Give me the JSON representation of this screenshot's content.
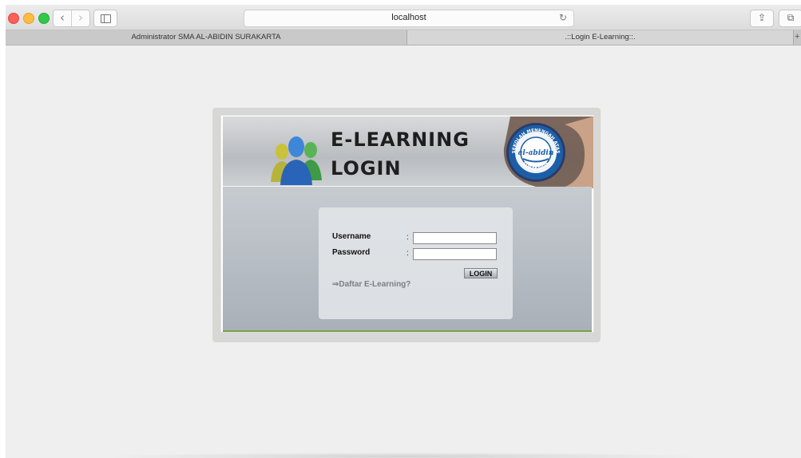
{
  "browser": {
    "url": "localhost",
    "back_icon": "‹",
    "forward_icon": "›",
    "reload_icon": "↻",
    "share_icon": "⇪",
    "tabs_icon": "⧉"
  },
  "tabs": [
    {
      "label": "Administrator SMA AL-ABIDIN SURAKARTA"
    },
    {
      "label": ".::Login E-Learning::."
    }
  ],
  "new_tab": "+",
  "login": {
    "title_line1": "E-LEARNING",
    "title_line2": "LOGIN",
    "username_label": "Username",
    "password_label": "Password",
    "colon": ":",
    "username_value": "",
    "password_value": "",
    "login_button": "LOGIN",
    "register_link": "⇒Daftar E-Learning?"
  },
  "logo": {
    "top_text": "SEKOLAH MENENGAH ATAS",
    "center_text": "al-abidin",
    "bottom_text": "SURAKARTA"
  },
  "colors": {
    "accent_green": "#7fa04a",
    "logo_blue": "#1c5fa8"
  }
}
